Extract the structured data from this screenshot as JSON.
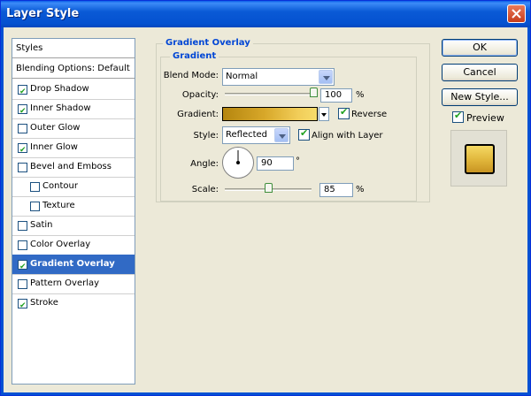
{
  "window": {
    "title": "Layer Style"
  },
  "styles_list": {
    "header": "Styles",
    "blending": "Blending Options: Default",
    "items": [
      {
        "label": "Drop Shadow",
        "checked": true,
        "indent": false
      },
      {
        "label": "Inner Shadow",
        "checked": true,
        "indent": false
      },
      {
        "label": "Outer Glow",
        "checked": false,
        "indent": false
      },
      {
        "label": "Inner Glow",
        "checked": true,
        "indent": false
      },
      {
        "label": "Bevel and Emboss",
        "checked": false,
        "indent": false
      },
      {
        "label": "Contour",
        "checked": false,
        "indent": true
      },
      {
        "label": "Texture",
        "checked": false,
        "indent": true
      },
      {
        "label": "Satin",
        "checked": false,
        "indent": false
      },
      {
        "label": "Color Overlay",
        "checked": false,
        "indent": false
      },
      {
        "label": "Gradient Overlay",
        "checked": true,
        "indent": false,
        "selected": true
      },
      {
        "label": "Pattern Overlay",
        "checked": false,
        "indent": false
      },
      {
        "label": "Stroke",
        "checked": true,
        "indent": false
      }
    ]
  },
  "panel": {
    "group_title": "Gradient Overlay",
    "subgroup_title": "Gradient",
    "blend_mode": {
      "label": "Blend Mode:",
      "value": "Normal"
    },
    "opacity": {
      "label": "Opacity:",
      "value": "100",
      "unit": "%",
      "level": 1.0
    },
    "gradient": {
      "label": "Gradient:",
      "reverse_label": "Reverse",
      "reverse_checked": true
    },
    "style": {
      "label": "Style:",
      "value": "Reflected",
      "align_label": "Align with Layer",
      "align_checked": true
    },
    "angle": {
      "label": "Angle:",
      "value": "90",
      "unit": "°"
    },
    "scale": {
      "label": "Scale:",
      "value": "85",
      "unit": "%",
      "level": 0.5
    }
  },
  "buttons": {
    "ok": "OK",
    "cancel": "Cancel",
    "new_style": "New Style...",
    "preview": "Preview",
    "preview_checked": true
  },
  "colors": {
    "title_bar": "#0a5ad6",
    "selection": "#316ac5",
    "group_title": "#0046d5",
    "gradient_start": "#b5860f",
    "gradient_end": "#f7dc6a"
  }
}
